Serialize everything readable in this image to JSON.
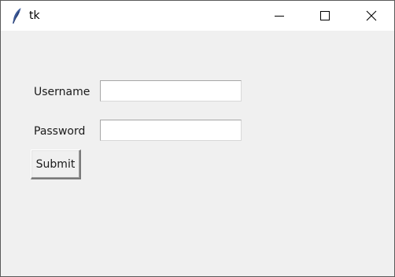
{
  "window": {
    "title": "tk",
    "icon": "feather-icon",
    "controls": [
      "minimize-icon",
      "maximize-icon",
      "close-icon"
    ]
  },
  "form": {
    "username_label": "Username",
    "username_value": "",
    "password_label": "Password",
    "password_value": "",
    "submit_label": "Submit"
  },
  "colors": {
    "background": "#f0f0f0",
    "titlebar": "#ffffff"
  }
}
